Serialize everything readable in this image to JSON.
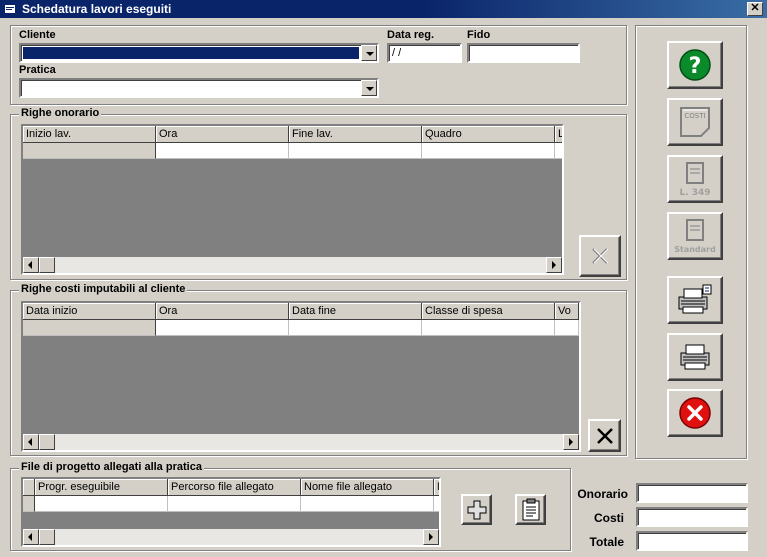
{
  "window": {
    "title": "Schedatura lavori eseguiti",
    "close_label": "✕"
  },
  "header": {
    "cliente_label": "Cliente",
    "pratica_label": "Pratica",
    "data_reg_label": "Data reg.",
    "data_reg_value": " / /",
    "fido_label": "Fido",
    "fido_value": ""
  },
  "onorario": {
    "title": "Righe onorario",
    "columns": [
      "Inizio lav.",
      "Ora",
      "Fine lav.",
      "Quadro",
      "L"
    ]
  },
  "costi": {
    "title": "Righe costi imputabili al cliente",
    "columns": [
      "Data inizio",
      "Ora",
      "Data fine",
      "Classe di spesa",
      "Vo"
    ]
  },
  "files": {
    "title": "File di progetto allegati alla pratica",
    "columns": [
      "",
      "Progr. eseguibile",
      "Percorso file allegato",
      "Nome file allegato",
      "N"
    ]
  },
  "totals": {
    "onorario_label": "Onorario",
    "costi_label": "Costi",
    "totale_label": "Totale",
    "onorario_value": "",
    "costi_value": "",
    "totale_value": ""
  },
  "side_buttons": {
    "costi_text": "COSTI",
    "l349_text": "L. 349",
    "standard_text": "Standard"
  },
  "colors": {
    "title_bar": "#0a246a",
    "window": "#d4d0c8",
    "grid_bg": "#808080"
  }
}
